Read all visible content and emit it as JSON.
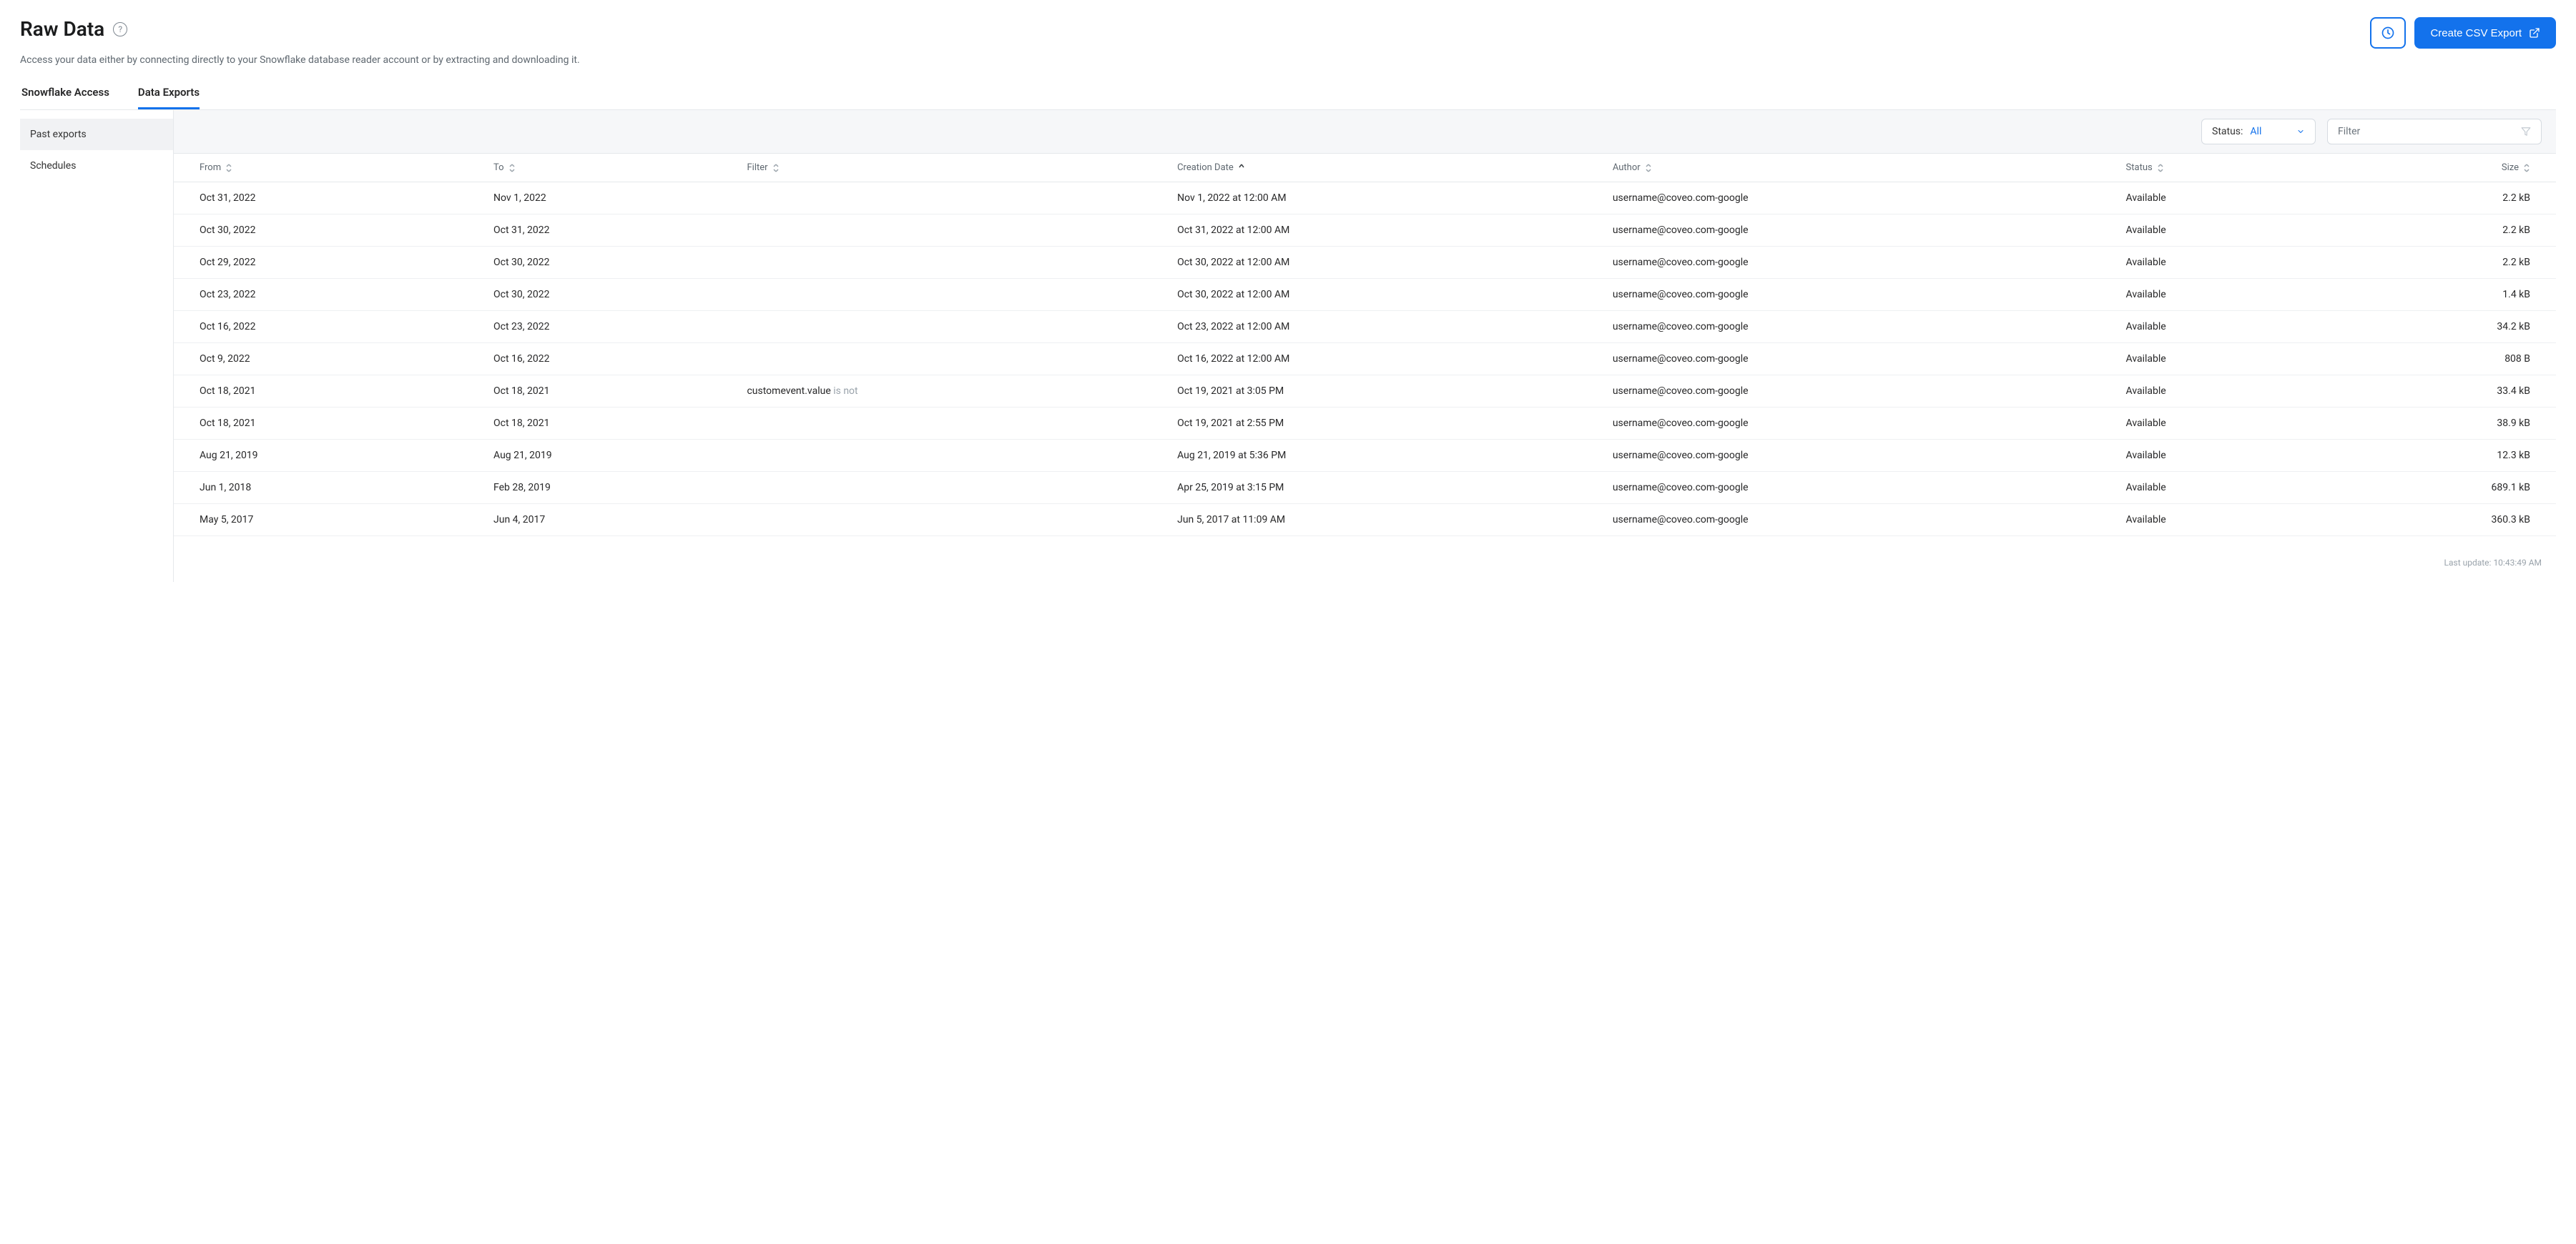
{
  "header": {
    "title": "Raw Data",
    "subtitle": "Access your data either by connecting directly to your Snowflake database reader account or by extracting and downloading it.",
    "create_button": "Create CSV Export"
  },
  "tabs": [
    {
      "label": "Snowflake Access",
      "active": false
    },
    {
      "label": "Data Exports",
      "active": true
    }
  ],
  "sidebar": [
    {
      "label": "Past exports",
      "active": true
    },
    {
      "label": "Schedules",
      "active": false
    }
  ],
  "toolbar": {
    "status_label": "Status:",
    "status_value": "All",
    "filter_placeholder": "Filter"
  },
  "columns": {
    "from": "From",
    "to": "To",
    "filter": "Filter",
    "creation": "Creation Date",
    "author": "Author",
    "status": "Status",
    "size": "Size"
  },
  "rows": [
    {
      "from": "Oct 31, 2022",
      "to": "Nov 1, 2022",
      "filter": "",
      "filter_suffix": "",
      "creation": "Nov 1, 2022 at 12:00 AM",
      "author": "username@coveo.com-google",
      "status": "Available",
      "size": "2.2 kB"
    },
    {
      "from": "Oct 30, 2022",
      "to": "Oct 31, 2022",
      "filter": "",
      "filter_suffix": "",
      "creation": "Oct 31, 2022 at 12:00 AM",
      "author": "username@coveo.com-google",
      "status": "Available",
      "size": "2.2 kB"
    },
    {
      "from": "Oct 29, 2022",
      "to": "Oct 30, 2022",
      "filter": "",
      "filter_suffix": "",
      "creation": "Oct 30, 2022 at 12:00 AM",
      "author": "username@coveo.com-google",
      "status": "Available",
      "size": "2.2 kB"
    },
    {
      "from": "Oct 23, 2022",
      "to": "Oct 30, 2022",
      "filter": "",
      "filter_suffix": "",
      "creation": "Oct 30, 2022 at 12:00 AM",
      "author": "username@coveo.com-google",
      "status": "Available",
      "size": "1.4 kB"
    },
    {
      "from": "Oct 16, 2022",
      "to": "Oct 23, 2022",
      "filter": "",
      "filter_suffix": "",
      "creation": "Oct 23, 2022 at 12:00 AM",
      "author": "username@coveo.com-google",
      "status": "Available",
      "size": "34.2 kB"
    },
    {
      "from": "Oct 9, 2022",
      "to": "Oct 16, 2022",
      "filter": "",
      "filter_suffix": "",
      "creation": "Oct 16, 2022 at 12:00 AM",
      "author": "username@coveo.com-google",
      "status": "Available",
      "size": "808 B"
    },
    {
      "from": "Oct 18, 2021",
      "to": "Oct 18, 2021",
      "filter": "customevent.value",
      "filter_suffix": " is not",
      "creation": "Oct 19, 2021 at 3:05 PM",
      "author": "username@coveo.com-google",
      "status": "Available",
      "size": "33.4 kB"
    },
    {
      "from": "Oct 18, 2021",
      "to": "Oct 18, 2021",
      "filter": "",
      "filter_suffix": "",
      "creation": "Oct 19, 2021 at 2:55 PM",
      "author": "username@coveo.com-google",
      "status": "Available",
      "size": "38.9 kB"
    },
    {
      "from": "Aug 21, 2019",
      "to": "Aug 21, 2019",
      "filter": "",
      "filter_suffix": "",
      "creation": "Aug 21, 2019 at 5:36 PM",
      "author": "username@coveo.com-google",
      "status": "Available",
      "size": "12.3 kB"
    },
    {
      "from": "Jun 1, 2018",
      "to": "Feb 28, 2019",
      "filter": "",
      "filter_suffix": "",
      "creation": "Apr 25, 2019 at 3:15 PM",
      "author": "username@coveo.com-google",
      "status": "Available",
      "size": "689.1 kB"
    },
    {
      "from": "May 5, 2017",
      "to": "Jun 4, 2017",
      "filter": "",
      "filter_suffix": "",
      "creation": "Jun 5, 2017 at 11:09 AM",
      "author": "username@coveo.com-google",
      "status": "Available",
      "size": "360.3 kB"
    }
  ],
  "footer": {
    "last_update_label": "Last update:",
    "last_update_time": "10:43:49 AM"
  }
}
